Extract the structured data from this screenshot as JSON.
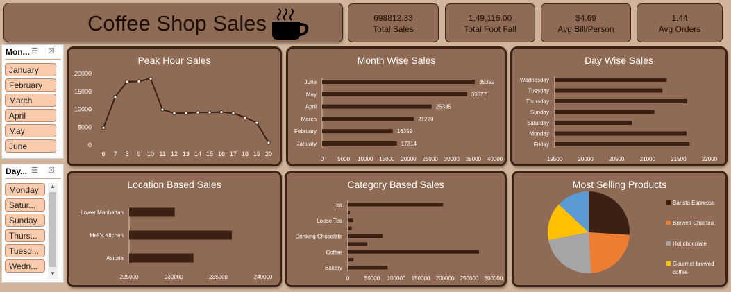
{
  "header": {
    "title": "Coffee Shop Sales",
    "icon": "coffee-cup-icon"
  },
  "kpis": [
    {
      "value": "698812.33",
      "label": "Total Sales"
    },
    {
      "value": "1,49,116.00",
      "label": "Total Foot Fall"
    },
    {
      "value": "$4.69",
      "label": "Avg Bill/Person"
    },
    {
      "value": "1.44",
      "label": "Avg Orders"
    }
  ],
  "slicers": {
    "month": {
      "header": "Mon...",
      "items": [
        "January",
        "February",
        "March",
        "April",
        "May",
        "June"
      ]
    },
    "day": {
      "header": "Day...",
      "items": [
        "Monday",
        "Satur...",
        "Sunday",
        "Thurs...",
        "Tuesd...",
        "Wedn..."
      ]
    }
  },
  "colors": {
    "bar": "#3b2014",
    "panel": "#8f6b55",
    "slicer_item": "#f8cbad"
  },
  "chart_data": [
    {
      "id": "peak_hour",
      "type": "line",
      "title": "Peak Hour Sales",
      "x": [
        6,
        7,
        8,
        9,
        10,
        11,
        12,
        13,
        14,
        15,
        16,
        17,
        18,
        19,
        20
      ],
      "values": [
        4800,
        13500,
        17700,
        17800,
        18600,
        9900,
        8900,
        8900,
        9100,
        9100,
        9200,
        8900,
        7700,
        6200,
        600
      ],
      "ylim": [
        0,
        20000
      ],
      "yticks": [
        0,
        5000,
        10000,
        15000,
        20000
      ]
    },
    {
      "id": "month_wise",
      "type": "bar",
      "orientation": "horizontal",
      "title": "Month Wise Sales",
      "categories": [
        "June",
        "May",
        "April",
        "March",
        "February",
        "January"
      ],
      "values": [
        35352,
        33527,
        25335,
        21229,
        16359,
        17314
      ],
      "data_labels": [
        "35352",
        "33527",
        "25335",
        "21229",
        "16359",
        "17314"
      ],
      "xlim": [
        0,
        40000
      ],
      "xticks": [
        0,
        5000,
        10000,
        15000,
        20000,
        25000,
        30000,
        35000,
        40000
      ]
    },
    {
      "id": "day_wise",
      "type": "bar",
      "orientation": "horizontal",
      "title": "Day Wise Sales",
      "categories": [
        "Wednesday",
        "Tuesday",
        "Thursday",
        "Sunday",
        "Saturday",
        "Monday",
        "Friday"
      ],
      "values": [
        21310,
        21240,
        21640,
        21110,
        20750,
        21630,
        21680
      ],
      "xlim": [
        19500,
        22000
      ],
      "xticks": [
        19500,
        20000,
        20500,
        21000,
        21500,
        22000
      ]
    },
    {
      "id": "location",
      "type": "bar",
      "orientation": "horizontal",
      "title": "Location Based Sales",
      "categories": [
        "Lower Manhattan",
        "Hell's Kitchen",
        "Astoria"
      ],
      "values": [
        230100,
        236500,
        232200
      ],
      "xlim": [
        225000,
        240000
      ],
      "xticks": [
        225000,
        230000,
        235000,
        240000
      ]
    },
    {
      "id": "category",
      "type": "bar",
      "orientation": "horizontal",
      "title": "Category Based Sales",
      "categories": [
        "Tea",
        "",
        "Loose Tea",
        "",
        "Drinking Chocolate",
        "",
        "Coffee",
        "",
        "Bakery"
      ],
      "values": [
        196000,
        4000,
        11000,
        8000,
        72000,
        40000,
        270000,
        12000,
        82000
      ],
      "xlim": [
        0,
        300000
      ],
      "xticks": [
        0,
        50000,
        100000,
        150000,
        200000,
        250000,
        300000
      ]
    },
    {
      "id": "products",
      "type": "pie",
      "title": "Most Selling Products",
      "categories": [
        "Barista Espresso",
        "Brewed Chai tea",
        "Hot chocolate",
        "Gourmet brewed coffee"
      ],
      "values": [
        26,
        23,
        23,
        15
      ],
      "extra_slice_values": [
        13
      ],
      "colors": [
        "#3b2014",
        "#ed7d31",
        "#a5a5a5",
        "#ffc000",
        "#5b9bd5"
      ]
    }
  ]
}
